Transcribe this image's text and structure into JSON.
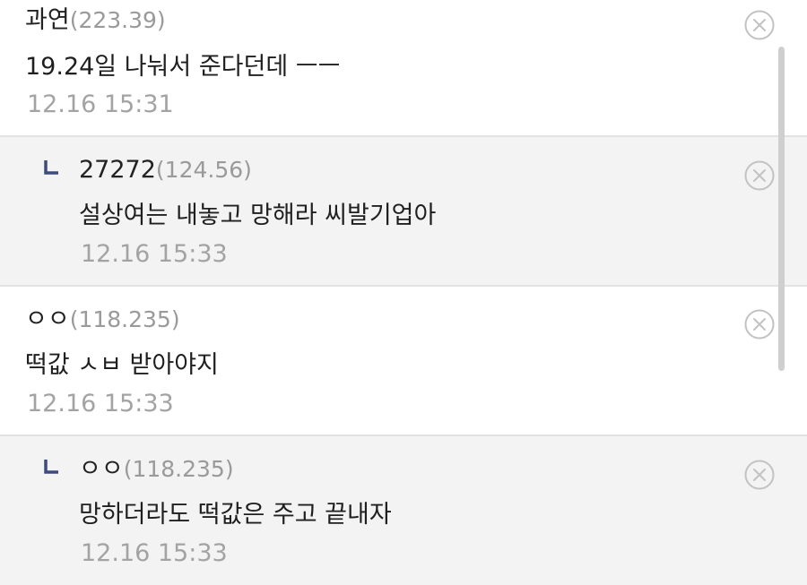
{
  "comments": [
    {
      "author": "과연",
      "ip": "(223.39)",
      "text": "19.24일 나눠서 준다던데 ㅡㅡ",
      "time": "12.16 15:31"
    },
    {
      "author": "27272",
      "ip": "(124.56)",
      "text": "설상여는 내놓고 망해라 씨발기업아",
      "time": "12.16 15:33"
    },
    {
      "author": "ㅇㅇ",
      "ip": "(118.235)",
      "text": "떡값 ㅅㅂ 받아야지",
      "time": "12.16 15:33"
    },
    {
      "author": "ㅇㅇ",
      "ip": "(118.235)",
      "text": "망하더라도 떡값은 주고 끝내자",
      "time": "12.16 15:33"
    }
  ],
  "colors": {
    "reply_background": "#f3f3f3",
    "divider": "#e2e2e2",
    "reply_arrow": "#3d4a80",
    "delete_icon": "#c2c2c2"
  },
  "icons": {
    "reply": "reply-arrow-icon",
    "delete": "delete-circle-x-icon"
  }
}
